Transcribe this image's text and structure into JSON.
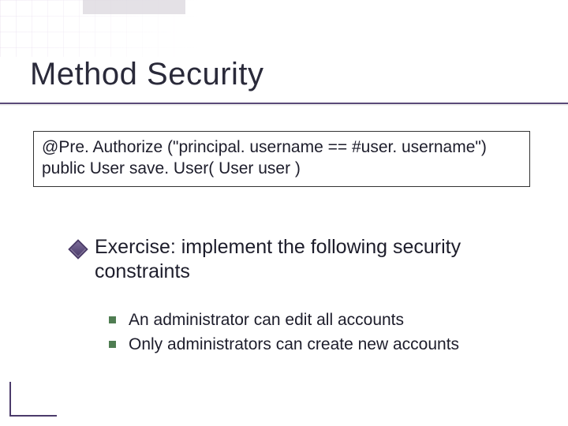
{
  "title": "Method Security",
  "code": {
    "line1": "@Pre. Authorize (\"principal. username == #user. username\")",
    "line2": "public User save. User( User user )"
  },
  "exercise": {
    "heading": "Exercise: implement the following security constraints",
    "items": [
      "An administrator can edit all accounts",
      "Only administrators can create new accounts"
    ]
  }
}
